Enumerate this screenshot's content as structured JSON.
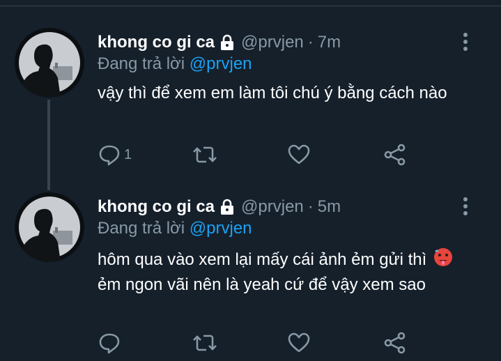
{
  "colors": {
    "background": "#15202b",
    "divider": "#38444d",
    "muted": "#8899a6",
    "mention": "#1da1f2",
    "text": "#ffffff"
  },
  "tweets": [
    {
      "name": "khong co gi ca",
      "handle": "@prvjen",
      "separator": "·",
      "time": "7m",
      "reply_prefix": "Đang trả lời",
      "reply_to": "@prvjen",
      "text_before_emoji": "vậy thì để xem em làm tôi chú ý bằng cách nào",
      "text_after_emoji": "",
      "reply_count": "1",
      "icons": [
        "lock-icon",
        "more-icon",
        "reply-icon",
        "retweet-icon",
        "like-icon",
        "share-icon"
      ]
    },
    {
      "name": "khong co gi ca",
      "handle": "@prvjen",
      "separator": "·",
      "time": "5m",
      "reply_prefix": "Đang trả lời",
      "reply_to": "@prvjen",
      "text_before_emoji": "hôm qua vào xem lại mấy cái ảnh ẻm gửi thì",
      "emoji": "hot-face-emoji",
      "text_after_emoji": "ẻm ngon vãi nên là yeah cứ để vậy xem sao",
      "reply_count": "",
      "icons": [
        "lock-icon",
        "more-icon",
        "reply-icon",
        "retweet-icon",
        "like-icon",
        "share-icon"
      ]
    }
  ]
}
